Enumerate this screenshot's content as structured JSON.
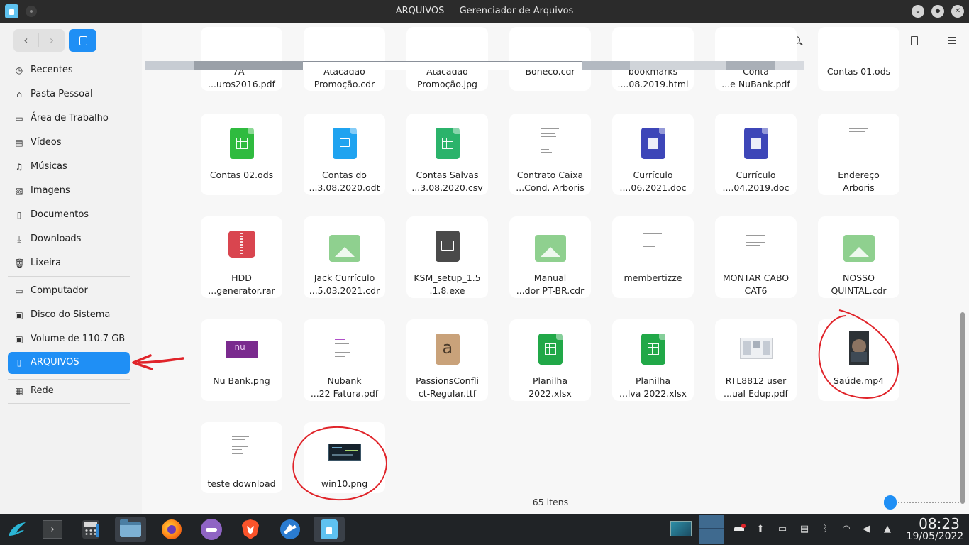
{
  "window": {
    "title": "ARQUIVOS — Gerenciador de Arquivos"
  },
  "sidebar": {
    "items": [
      {
        "label": "Recentes",
        "icon": "clock-icon"
      },
      {
        "label": "Pasta Pessoal",
        "icon": "home-icon"
      },
      {
        "label": "Área de Trabalho",
        "icon": "desktop-icon"
      },
      {
        "label": "Vídeos",
        "icon": "film-icon"
      },
      {
        "label": "Músicas",
        "icon": "music-icon"
      },
      {
        "label": "Imagens",
        "icon": "image-icon"
      },
      {
        "label": "Documentos",
        "icon": "document-icon"
      },
      {
        "label": "Downloads",
        "icon": "download-icon"
      },
      {
        "label": "Lixeira",
        "icon": "trash-icon"
      }
    ],
    "devices": [
      {
        "label": "Computador",
        "icon": "computer-icon"
      },
      {
        "label": "Disco do Sistema",
        "icon": "disk-icon"
      },
      {
        "label": "Volume de 110.7 GB",
        "icon": "disk-icon"
      },
      {
        "label": "ARQUIVOS",
        "icon": "usb-drive-icon",
        "active": true
      },
      {
        "label": "Rede",
        "icon": "network-icon"
      }
    ]
  },
  "files": {
    "row0": [
      {
        "l1": "7A -",
        "l2": "...uros2016.pdf"
      },
      {
        "l1": "Atacadão",
        "l2": "Promoção.cdr"
      },
      {
        "l1": "Atacadão",
        "l2": "Promoção.jpg"
      },
      {
        "l1": "Boneco.cdr",
        "l2": ""
      },
      {
        "l1": "bookmarks",
        "l2": "....08.2019.html"
      },
      {
        "l1": "Conta",
        "l2": "...e NuBank.pdf"
      },
      {
        "l1": "Contas 01.ods",
        "l2": ""
      }
    ],
    "row1": [
      {
        "l1": "Contas 02.ods",
        "l2": "",
        "kind": "spreadsheet"
      },
      {
        "l1": "Contas do",
        "l2": "...3.08.2020.odt",
        "kind": "text-doc"
      },
      {
        "l1": "Contas Salvas",
        "l2": "...3.08.2020.csv",
        "kind": "csv"
      },
      {
        "l1": "Contrato Caixa",
        "l2": "...Cond. Arboris",
        "kind": "preview"
      },
      {
        "l1": "Currículo",
        "l2": "....06.2021.doc",
        "kind": "word"
      },
      {
        "l1": "Currículo",
        "l2": "....04.2019.doc",
        "kind": "word"
      },
      {
        "l1": "Endereço",
        "l2": "Arboris",
        "kind": "preview"
      }
    ],
    "row2": [
      {
        "l1": "HDD",
        "l2": "...generator.rar",
        "kind": "archive"
      },
      {
        "l1": "Jack Currículo",
        "l2": "...5.03.2021.cdr",
        "kind": "image"
      },
      {
        "l1": "KSM_setup_1.5",
        "l2": ".1.8.exe",
        "kind": "exe"
      },
      {
        "l1": "Manual",
        "l2": "...dor PT-BR.cdr",
        "kind": "image"
      },
      {
        "l1": "membertizze",
        "l2": "",
        "kind": "preview"
      },
      {
        "l1": "MONTAR CABO",
        "l2": "CAT6",
        "kind": "preview"
      },
      {
        "l1": "NOSSO",
        "l2": "QUINTAL.cdr",
        "kind": "image"
      }
    ],
    "row3": [
      {
        "l1": "Nu Bank.png",
        "l2": "",
        "kind": "nubank"
      },
      {
        "l1": "Nubank",
        "l2": "...22 Fatura.pdf",
        "kind": "pdf-preview"
      },
      {
        "l1": "PassionsConfli",
        "l2": "ct-Regular.ttf",
        "kind": "font"
      },
      {
        "l1": "Planilha",
        "l2": "2022.xlsx",
        "kind": "xlsx"
      },
      {
        "l1": "Planilha",
        "l2": "...lva 2022.xlsx",
        "kind": "xlsx"
      },
      {
        "l1": "RTL8812 user",
        "l2": "...ual Edup.pdf",
        "kind": "manual"
      },
      {
        "l1": "Saúde.mp4",
        "l2": "",
        "kind": "video"
      }
    ],
    "row4": [
      {
        "l1": "teste download",
        "l2": "",
        "kind": "preview"
      },
      {
        "l1": "win10.png",
        "l2": "",
        "kind": "screenshot"
      }
    ]
  },
  "status": {
    "count": "65 itens"
  },
  "nubank_logo_text": "nu",
  "font_preview_glyph": "a",
  "clock": {
    "time": "08:23",
    "date": "19/05/2022"
  },
  "colors": {
    "accent": "#1f8ff5",
    "annotation": "#e0242a"
  }
}
